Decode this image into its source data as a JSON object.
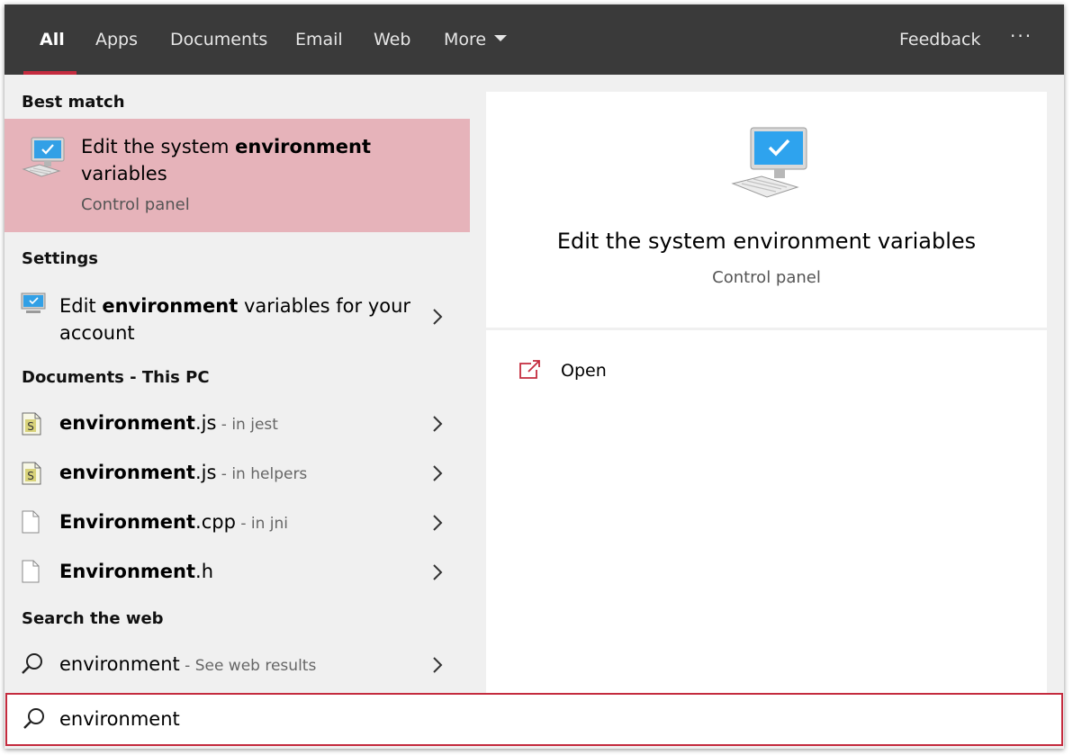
{
  "tabs": {
    "all": "All",
    "apps": "Apps",
    "documents": "Documents",
    "email": "Email",
    "web": "Web",
    "more": "More",
    "feedback": "Feedback",
    "options": "···"
  },
  "colors": {
    "accent": "#c42b3e",
    "topbar": "#3a3a3a",
    "highlight": "#e6b3ba"
  },
  "best_match": {
    "heading": "Best match",
    "title_pre": "Edit the system ",
    "title_bold": "environment",
    "title_post": "variables",
    "subtitle": "Control panel",
    "icon": "computer-monitor-icon"
  },
  "settings": {
    "heading": "Settings",
    "item": {
      "pre": "Edit ",
      "bold": "environment",
      "post": " variables for your",
      "line2": "account",
      "icon": "settings-monitor-icon"
    }
  },
  "documents": {
    "heading": "Documents - This PC",
    "items": [
      {
        "bold": "environment",
        "ext": ".js",
        "meta": " - in jest",
        "icon": "js-file-icon"
      },
      {
        "bold": "environment",
        "ext": ".js",
        "meta": " - in helpers",
        "icon": "js-file-icon"
      },
      {
        "bold": "Environment",
        "ext": ".cpp",
        "meta": " - in jni",
        "icon": "blank-file-icon"
      },
      {
        "bold": "Environment",
        "ext": ".h",
        "meta": "",
        "icon": "blank-file-icon"
      }
    ]
  },
  "web": {
    "heading": "Search the web",
    "item": {
      "bold": "environment",
      "meta": " - See web results",
      "icon": "search-icon"
    }
  },
  "preview": {
    "title": "Edit the system environment variables",
    "subtitle": "Control panel",
    "open_label": "Open"
  },
  "search": {
    "value": "environment"
  }
}
